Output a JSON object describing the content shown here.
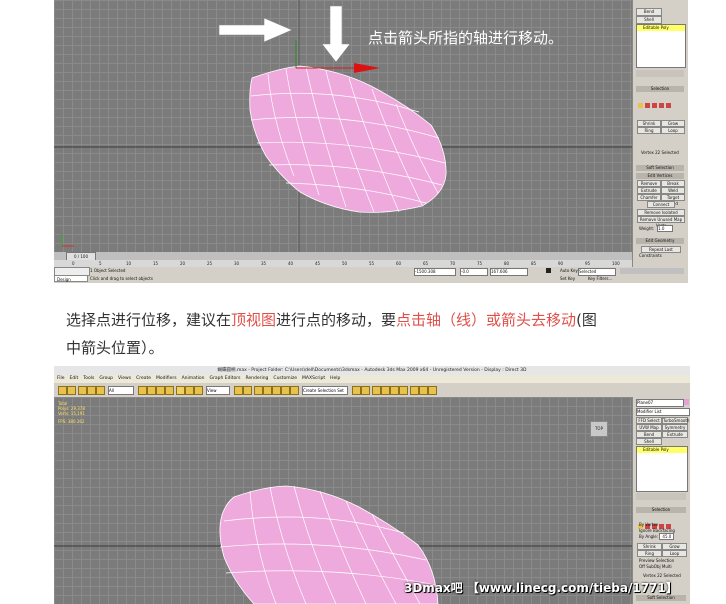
{
  "top_screenshot": {
    "caption": "点击箭头所指的轴进行移动。",
    "side_panel": {
      "buttons": [
        "Bend",
        "Shell"
      ],
      "modifier_stack": [
        "Editable Poly"
      ],
      "rollouts": [
        "Selection",
        "Soft Selection",
        "Edit Vertices",
        "Edit Geometry"
      ],
      "selection_buttons": [
        "Shrink",
        "Grow",
        "Ring",
        "Loop"
      ],
      "edit_vertex_buttons": [
        "Remove",
        "Break",
        "Extrude",
        "Weld",
        "Chamfer",
        "Target Weld",
        "Connect",
        "Remove Isolated Vertices",
        "Remove Unused Map Verts"
      ],
      "weight_label": "Weight:",
      "weight_value": "1.0",
      "vertices_selected": "Vertex 22 Selected",
      "repeat_last": "Repeat Last",
      "constraints_label": "Constraints"
    },
    "time_slider": "0 / 100",
    "status_text": "1 Object Selected",
    "prompt_text": "Click and drag to select objects",
    "x_value": "-1500.308",
    "y_value": "-0.0",
    "z_value": "167.606",
    "auto_key": "Auto Key",
    "set_key": "Set Key",
    "key_mode": "Selected",
    "key_filters": "Key Filters...",
    "design_label": "Design",
    "ruler": [
      "0",
      "5",
      "10",
      "15",
      "20",
      "25",
      "30",
      "35",
      "40",
      "45",
      "50",
      "55",
      "60",
      "65",
      "70",
      "75",
      "80",
      "85",
      "90",
      "95",
      "100"
    ]
  },
  "paragraph": {
    "line1_part1": "选择点进行位移，建议在",
    "line1_red1": "顶视图",
    "line1_part2": "进行点的移动，要",
    "line1_red2": "点击轴（线）或箭头去移动",
    "line1_part3": "(图",
    "line2": "中箭头位置）。"
  },
  "bottom_screenshot": {
    "title": "蝴蝶圆柄.max   - Project Folder: C:\\Users\\dell\\Documents\\3dsmax    - Autodesk 3ds Max  2009 x64  - Unregistered Version    - Display : Direct 3D",
    "menus": [
      "File",
      "Edit",
      "Tools",
      "Group",
      "Views",
      "Create",
      "Modifiers",
      "Animation",
      "Graph Editors",
      "Rendering",
      "Customize",
      "MAXScript",
      "Help"
    ],
    "toolbar": {
      "filter_all": "All",
      "view_dropdown": "View",
      "selection_set": "Create Selection Set"
    },
    "side_panel": {
      "object_name": "Plane07",
      "modifier_list": "Modifier List",
      "buttons": [
        "FFD Select",
        "TurboSmooth",
        "UVW Map",
        "Symmetry",
        "Bend",
        "Extrude",
        "Shell"
      ],
      "modifier_stack": [
        "Editable Poly"
      ],
      "rollouts": [
        "Selection",
        "Soft Selection"
      ],
      "selection_buttons": [
        "Shrink",
        "Grow",
        "Ring",
        "Loop"
      ],
      "by_vertex": "By Vertex",
      "ignore_backfacing": "Ignore Backfacing",
      "by_angle": "By Angle:",
      "by_angle_value": "45.0",
      "preview_selection": "Preview Selection",
      "preview_options": [
        "Off",
        "SubObj",
        "Multi"
      ],
      "vertices_selected": "Vertex 22 Selected"
    },
    "stats": [
      "Total",
      "Polys:  29,378",
      "Verts:  15,191",
      "FPS:    380.362"
    ],
    "viewcube_label": "TOP"
  },
  "watermark": "3Dmax吧 【www.linecg.com/tieba/1771】",
  "colors": {
    "mesh_fill": "#eeaadd",
    "viewport_bg": "#7b7b7b",
    "highlight_red": "#e0504a",
    "stack_highlight": "#ffff66"
  }
}
